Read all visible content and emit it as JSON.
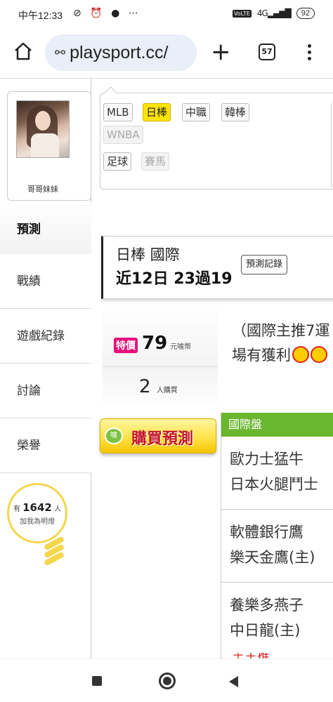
{
  "status_bar": {
    "time": "中午12:33",
    "left_icons": "⊘ ⏰ ● ⋯",
    "volte": "VoLTE",
    "signal": "4G",
    "battery": "92"
  },
  "browser": {
    "url": "playsport.cc/",
    "tab_count": "57"
  },
  "sidebar": {
    "user_name": "哥哥妹妹",
    "nav_items": [
      {
        "label": "預測"
      },
      {
        "label": "戰績"
      },
      {
        "label": "遊戲紀錄"
      },
      {
        "label": "討論"
      },
      {
        "label": "榮譽"
      }
    ],
    "lamp": {
      "prefix": "有",
      "count": "1642",
      "suffix": "人",
      "caption": "加我為明燈"
    }
  },
  "filters": {
    "tags": [
      "MLB",
      "日棒",
      "中職",
      "韓棒",
      "WNBA",
      "足球",
      "賽馬"
    ],
    "active": "日棒"
  },
  "prediction": {
    "title": "日棒 國際",
    "record_summary": "近12日 23過19",
    "record_button": "預測記錄"
  },
  "pricing": {
    "sale_badge": "特價",
    "price": "79",
    "price_unit": "元噱幣",
    "buyers": "2",
    "buyers_unit": "人購買",
    "buy_button": "購買預測",
    "coin_label": "噱"
  },
  "promo": {
    "line1": "（國際主推7運",
    "line2": "場有獲利"
  },
  "matches": {
    "header": "國際盤",
    "rows": [
      {
        "team1": "歐力士猛牛",
        "team2": "日本火腿鬥士"
      },
      {
        "team1": "軟體銀行鷹",
        "team2": "樂天金鷹(主)"
      },
      {
        "team1": "養樂多燕子",
        "team2": "中日龍(主)"
      }
    ],
    "peek": "＋主推"
  }
}
